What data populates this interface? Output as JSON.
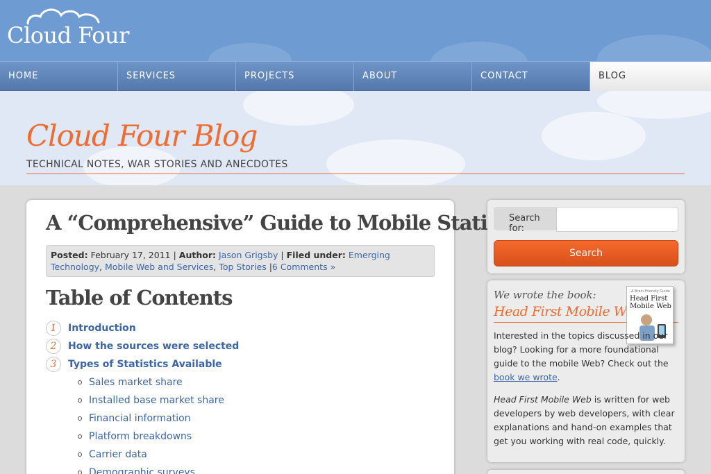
{
  "site": {
    "logo_text": "Cloud Four"
  },
  "nav": {
    "items": [
      {
        "label": "HOME"
      },
      {
        "label": "SERVICES"
      },
      {
        "label": "PROJECTS"
      },
      {
        "label": "ABOUT"
      },
      {
        "label": "CONTACT"
      },
      {
        "label": "BLOG"
      }
    ],
    "active": "BLOG"
  },
  "blog": {
    "title": "Cloud Four Blog",
    "subtitle": "TECHNICAL NOTES, WAR STORIES AND ANECDOTES"
  },
  "post": {
    "title": "A “Comprehensive” Guide to Mobile Statistics",
    "meta": {
      "posted_label": "Posted:",
      "date": "February 17, 2011",
      "sep1": " | ",
      "author_label": "Author:",
      "author": "Jason Grigsby",
      "sep2": " | ",
      "filed_label": "Filed under:",
      "cat1": "Emerging Technology",
      "comma1": ", ",
      "cat2": "Mobile Web and Services",
      "comma2": ", ",
      "cat3": "Top Stories",
      "sep3": " |",
      "comments": "6 Comments »"
    },
    "toc_heading": "Table of Contents",
    "toc": [
      {
        "num": "1",
        "label": "Introduction"
      },
      {
        "num": "2",
        "label": "How the sources were selected"
      },
      {
        "num": "3",
        "label": "Types of Statistics Available"
      }
    ],
    "toc_sub": [
      "Sales market share",
      "Installed base market share",
      "Financial information",
      "Platform breakdowns",
      "Carrier data",
      "Demographic surveys"
    ]
  },
  "sidebar": {
    "search": {
      "label": "Search for:",
      "value": "",
      "placeholder": "",
      "button": "Search"
    },
    "book": {
      "kicker": "We wrote the book:",
      "title": "Head First Mobile Web",
      "cover_small": "A Brain-Friendly Guide",
      "cover_title": "Head First Mobile Web",
      "p1_text": "Interested in the topics discussed in our blog? Looking for a more foundational guide to the mobile Web? Check out the ",
      "p1_link": "book we wrote",
      "p1_end": ".",
      "p2_em": "Head First Mobile Web",
      "p2_text": " is written for web developers by web developers, with clear explanations and hand-on examples that get you working with real code, quickly."
    }
  },
  "colors": {
    "header_blue": "#6e9bd2",
    "accent_orange": "#f16a2f",
    "link_blue": "#3a66a8"
  }
}
